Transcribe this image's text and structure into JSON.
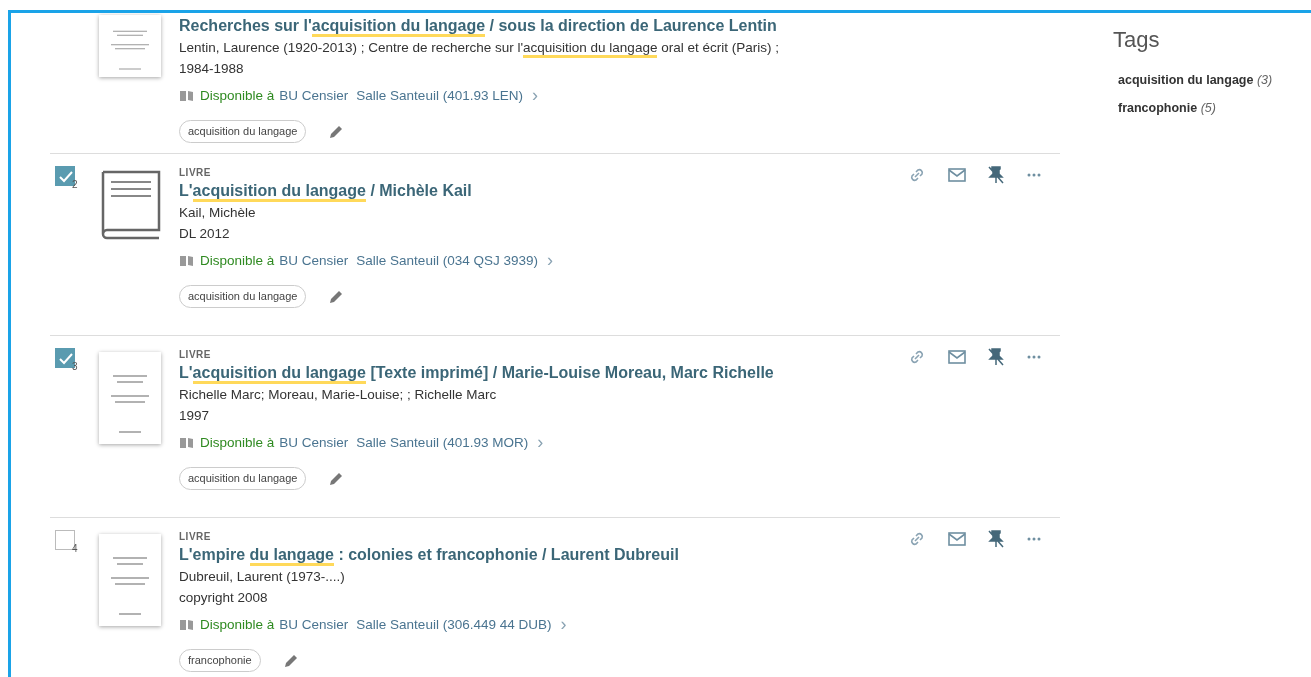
{
  "records": [
    {
      "thumbnail": {
        "kind": "cover"
      },
      "title": [
        {
          "text": "Recherches sur l'",
          "highlighted": false
        },
        {
          "text": "acquisition du langage",
          "highlighted": true
        },
        {
          "text": " / sous la direction de Laurence Lentin",
          "highlighted": false
        }
      ],
      "author": [
        {
          "text": "Lentin, Laurence (1920-2013) ; Centre de recherche sur l'",
          "highlighted": false
        },
        {
          "text": "acquisition du langage",
          "highlighted": true
        },
        {
          "text": " oral et écrit (Paris) ;",
          "highlighted": false
        }
      ],
      "date": "1984-1988",
      "availability": {
        "status": "Disponible à",
        "library": "BU Censier",
        "location": "Salle Santeuil (401.93 LEN)",
        "chevron": "›"
      },
      "tags": [
        "acquisition du langage"
      ]
    },
    {
      "number": "2",
      "checked": true,
      "type": "LIVRE",
      "thumbnail": {
        "kind": "generic"
      },
      "title": [
        {
          "text": "L'",
          "highlighted": false
        },
        {
          "text": "acquisition du langage",
          "highlighted": true
        },
        {
          "text": " / Michèle Kail",
          "highlighted": false
        }
      ],
      "author": [
        {
          "text": "Kail, Michèle",
          "highlighted": false
        }
      ],
      "date": "DL 2012",
      "availability": {
        "status": "Disponible à",
        "library": "BU Censier",
        "location": "Salle Santeuil (034 QSJ 3939)",
        "chevron": "›"
      },
      "tags": [
        "acquisition du langage"
      ],
      "actions": true
    },
    {
      "number": "3",
      "checked": true,
      "type": "LIVRE",
      "thumbnail": {
        "kind": "cover"
      },
      "title": [
        {
          "text": "L'",
          "highlighted": false
        },
        {
          "text": "acquisition du langage",
          "highlighted": true
        },
        {
          "text": " [Texte imprimé] / Marie-Louise Moreau, Marc Richelle",
          "highlighted": false
        }
      ],
      "author": [
        {
          "text": "Richelle Marc; Moreau, Marie-Louise; ; Richelle Marc",
          "highlighted": false
        }
      ],
      "date": "1997",
      "availability": {
        "status": "Disponible à",
        "library": "BU Censier",
        "location": "Salle Santeuil (401.93 MOR)",
        "chevron": "›"
      },
      "tags": [
        "acquisition du langage"
      ],
      "actions": true
    },
    {
      "number": "4",
      "checked": false,
      "type": "LIVRE",
      "thumbnail": {
        "kind": "cover"
      },
      "title": [
        {
          "text": "L'empire ",
          "highlighted": false
        },
        {
          "text": "du langage",
          "highlighted": true
        },
        {
          "text": " : colonies et francophonie / Laurent Dubreuil",
          "highlighted": false
        }
      ],
      "author": [
        {
          "text": "Dubreuil, Laurent (1973-....)",
          "highlighted": false
        }
      ],
      "date": "copyright 2008",
      "availability": {
        "status": "Disponible à",
        "library": "BU Censier",
        "location": "Salle Santeuil (306.449 44 DUB)",
        "chevron": "›"
      },
      "tags": [
        "francophonie"
      ],
      "actions": true
    }
  ],
  "sidebar": {
    "title": "Tags",
    "tags": [
      {
        "label": "acquisition du langage",
        "count": "(3)"
      },
      {
        "label": "francophonie",
        "count": "(5)"
      }
    ]
  }
}
